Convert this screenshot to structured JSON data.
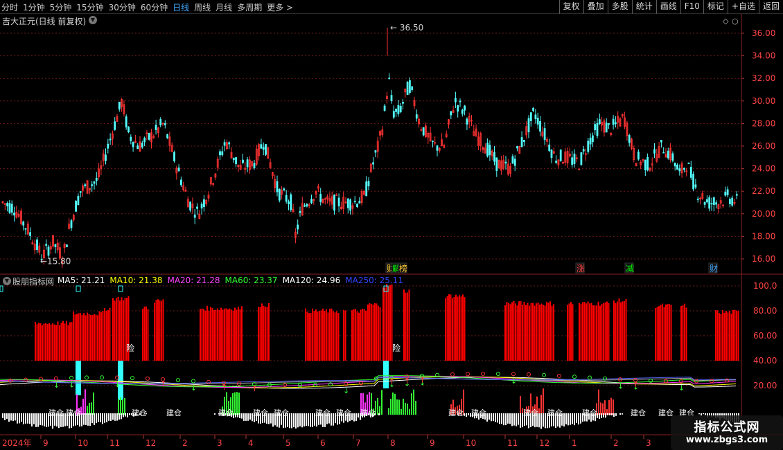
{
  "toolbar": {
    "periods": [
      "分时",
      "1分钟",
      "5分钟",
      "15分钟",
      "30分钟",
      "60分钟",
      "日线",
      "周线",
      "月线",
      "多周期",
      "更多 >"
    ],
    "active_period": "日线",
    "actions": [
      "复权",
      "叠加",
      "多股",
      "统计",
      "画线",
      "F10",
      "标记",
      "+自选",
      "返回"
    ]
  },
  "main_chart": {
    "title": "吉大正元(日线 前复权)",
    "high_label": "36.50",
    "low_label": "15.80",
    "price_ticks": [
      "36.00",
      "34.00",
      "32.00",
      "30.00",
      "28.00",
      "26.00",
      "24.00",
      "22.00",
      "20.00",
      "18.00",
      "16.00"
    ],
    "event_tags": [
      "财",
      "解",
      "榜",
      "涨",
      "减",
      "财"
    ]
  },
  "indicator": {
    "name": "股朋指标网",
    "ma": [
      {
        "label": "MA5:",
        "value": "21.21",
        "color": "#ffffff"
      },
      {
        "label": "MA10:",
        "value": "21.38",
        "color": "#ffff00"
      },
      {
        "label": "MA20:",
        "value": "21.28",
        "color": "#ff44ff"
      },
      {
        "label": "MA60:",
        "value": "23.37",
        "color": "#33ff33"
      },
      {
        "label": "MA120:",
        "value": "24.96",
        "color": "#ffffff"
      },
      {
        "label": "MA250:",
        "value": "25.11",
        "color": "#3344ff"
      }
    ],
    "ticks": [
      "100.0",
      "80.00",
      "60.00",
      "40.00",
      "20.00"
    ],
    "labels": {
      "risk": "险",
      "build": "建仓"
    }
  },
  "time_axis": [
    "2024年",
    "9",
    "10",
    "11",
    "12",
    "2",
    "3",
    "4",
    "5",
    "6",
    "7",
    "8",
    "9",
    "10",
    "11",
    "12",
    "1",
    "2",
    "3"
  ],
  "colors": {
    "up": "#ff3333",
    "down": "#54ffff",
    "red_bar": "#ff0000",
    "cyan": "#33ffff",
    "green": "#33ff33",
    "magenta": "#ff33ff",
    "grid": "#6b1a1a"
  },
  "watermark": {
    "title": "指标公式网",
    "url": "www.zbgs3.com"
  }
}
